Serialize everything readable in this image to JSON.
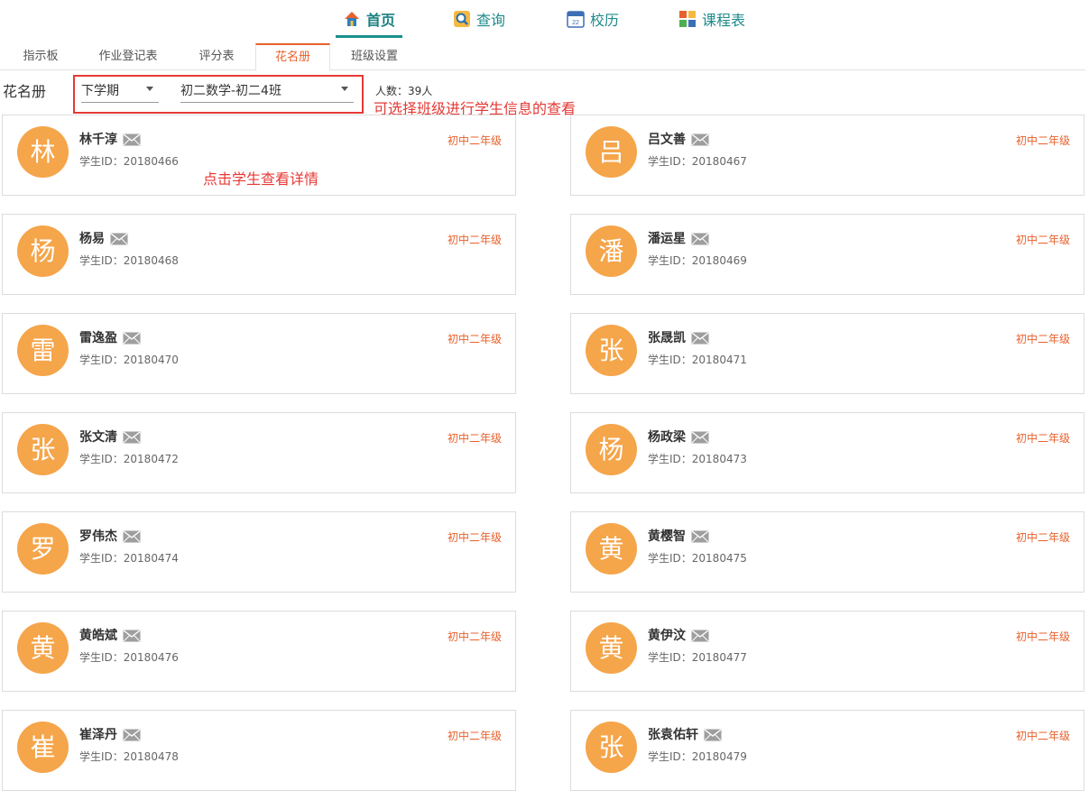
{
  "nav": {
    "items": [
      {
        "label": "首页",
        "icon": "home-icon"
      },
      {
        "label": "查询",
        "icon": "search-icon"
      },
      {
        "label": "校历",
        "icon": "calendar-icon"
      },
      {
        "label": "课程表",
        "icon": "schedule-icon"
      }
    ],
    "active": "首页"
  },
  "subtabs": {
    "items": [
      "指示板",
      "作业登记表",
      "评分表",
      "花名册",
      "班级设置"
    ],
    "active": "花名册"
  },
  "roster": {
    "title": "花名册",
    "term_select": "下学期",
    "class_select": "初二数学-初二4班",
    "count": "人数：39人"
  },
  "annotations": {
    "select_hint": "可选择班级进行学生信息的查看",
    "click_hint": "点击学生查看详情"
  },
  "students": [
    {
      "initial": "林",
      "name": "林千淳",
      "id": "学生ID：20180466",
      "grade": "初中二年级"
    },
    {
      "initial": "吕",
      "name": "吕文善",
      "id": "学生ID：20180467",
      "grade": "初中二年级"
    },
    {
      "initial": "杨",
      "name": "杨易",
      "id": "学生ID：20180468",
      "grade": "初中二年级"
    },
    {
      "initial": "潘",
      "name": "潘运星",
      "id": "学生ID：20180469",
      "grade": "初中二年级"
    },
    {
      "initial": "雷",
      "name": "雷逸盈",
      "id": "学生ID：20180470",
      "grade": "初中二年级"
    },
    {
      "initial": "张",
      "name": "张晟凯",
      "id": "学生ID：20180471",
      "grade": "初中二年级"
    },
    {
      "initial": "张",
      "name": "张文清",
      "id": "学生ID：20180472",
      "grade": "初中二年级"
    },
    {
      "initial": "杨",
      "name": "杨政梁",
      "id": "学生ID：20180473",
      "grade": "初中二年级"
    },
    {
      "initial": "罗",
      "name": "罗伟杰",
      "id": "学生ID：20180474",
      "grade": "初中二年级"
    },
    {
      "initial": "黄",
      "name": "黄樱智",
      "id": "学生ID：20180475",
      "grade": "初中二年级"
    },
    {
      "initial": "黄",
      "name": "黄皓斌",
      "id": "学生ID：20180476",
      "grade": "初中二年级"
    },
    {
      "initial": "黄",
      "name": "黄伊汶",
      "id": "学生ID：20180477",
      "grade": "初中二年级"
    },
    {
      "initial": "崔",
      "name": "崔泽丹",
      "id": "学生ID：20180478",
      "grade": "初中二年级"
    },
    {
      "initial": "张",
      "name": "张袁佑轩",
      "id": "学生ID：20180479",
      "grade": "初中二年级"
    }
  ],
  "colors": {
    "accent": "#e8612c",
    "teal": "#1a8f8f",
    "avatar": "#f5a54a",
    "annotation": "#e53935"
  }
}
